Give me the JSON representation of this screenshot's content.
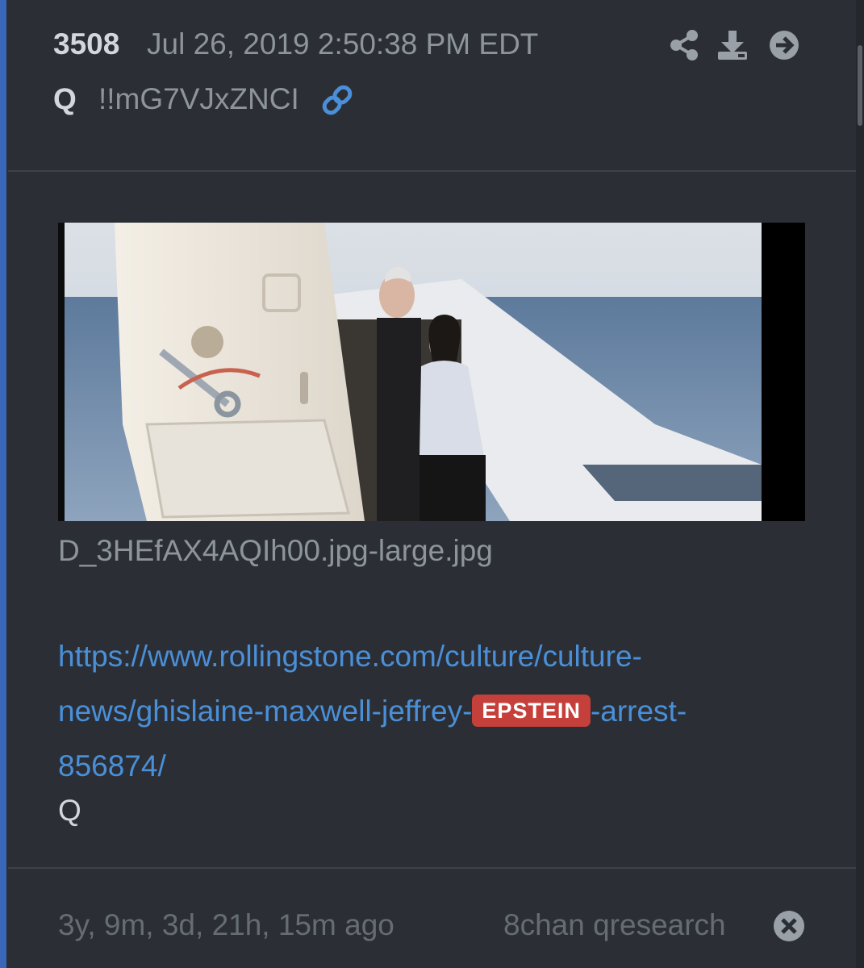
{
  "post": {
    "number": "3508",
    "date": "Jul 26, 2019 2:50:38 PM EDT",
    "author": "Q",
    "tripcode": "!!mG7VJxZNCI",
    "attachment": {
      "filename": "D_3HEfAX4AQIh00.jpg-large.jpg"
    },
    "url_before_tag": "https://www.rollingstone.com/culture/culture-news/ghislaine-maxwell-jeffrey-",
    "url_tag": "EPSTEIN",
    "url_after_tag": "-arrest-856874/",
    "signature": "Q"
  },
  "footer": {
    "time_ago": "3y, 9m, 3d, 21h, 15m ago",
    "source": "8chan qresearch"
  },
  "icons": [
    "share-icon",
    "download-icon",
    "arrow-right-circle-icon",
    "link-icon",
    "close-circle-icon"
  ],
  "colors": {
    "background": "#2b2f35",
    "accent_bar": "#3a67b8",
    "link": "#4a8fd8",
    "tag": "#c5403a",
    "muted_text": "#8d949c"
  }
}
